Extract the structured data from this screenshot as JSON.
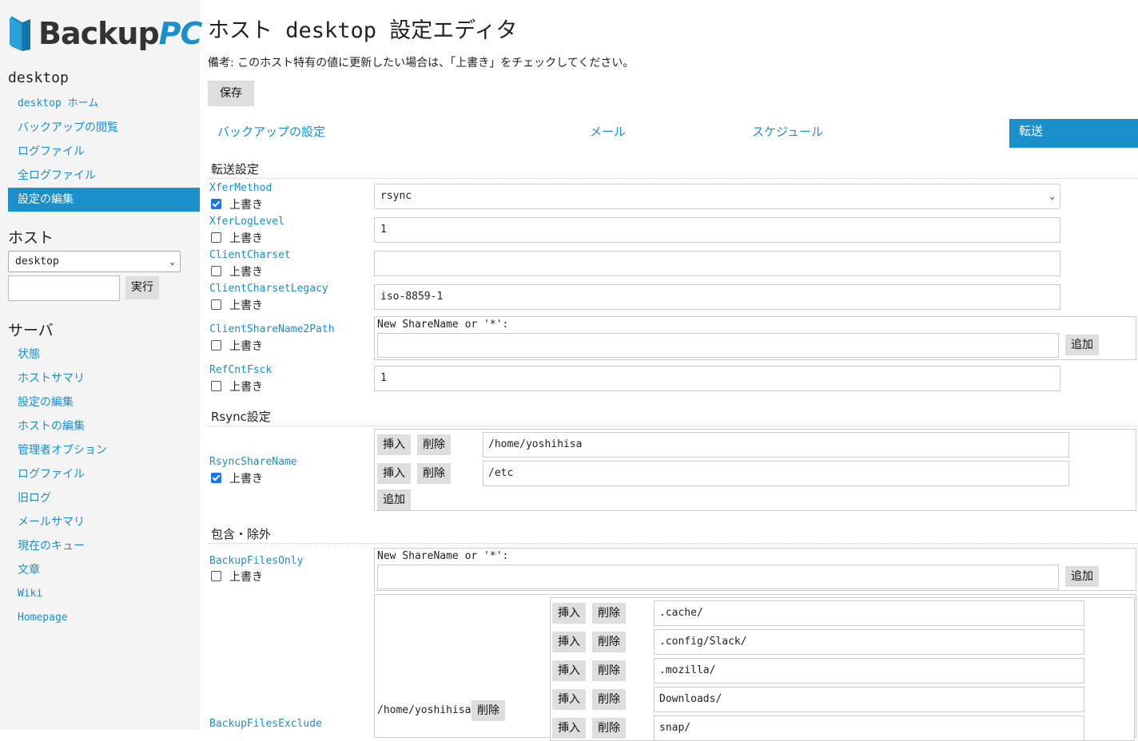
{
  "brand": {
    "name_a": "Backup",
    "name_b": "PC",
    "accent": "#1a8fc9"
  },
  "sidebar": {
    "host_heading": "desktop",
    "host_links": [
      "desktop ホーム",
      "バックアップの閲覧",
      "ログファイル",
      "全ログファイル",
      "設定の編集"
    ],
    "hosts_heading": "ホスト",
    "host_select_value": "desktop",
    "go_label": "実行",
    "server_heading": "サーバ",
    "server_links": [
      "状態",
      "ホストサマリ",
      "設定の編集",
      "ホストの編集",
      "管理者オプション",
      "ログファイル",
      "旧ログ",
      "メールサマリ",
      "現在のキュー",
      "文章",
      "Wiki",
      "Homepage"
    ]
  },
  "main": {
    "title": "ホスト desktop 設定エディタ",
    "note": "備考: このホスト特有の値に更新したい場合は、「上書き」をチェックしてください。",
    "save_label": "保存",
    "tabs": [
      "バックアップの設定",
      "メール",
      "スケジュール",
      "転送"
    ],
    "override_label": "上書き",
    "insert_label": "挿入",
    "delete_label": "削除",
    "add_label": "追加",
    "new_share_label": "New ShareName or '*':",
    "sections": {
      "xfer": "転送設定",
      "rsync": "Rsync設定",
      "include": "包含・除外"
    },
    "params": {
      "XferMethod": {
        "name": "XferMethod",
        "value": "rsync",
        "override": true
      },
      "XferLogLevel": {
        "name": "XferLogLevel",
        "value": "1",
        "override": false
      },
      "ClientCharset": {
        "name": "ClientCharset",
        "value": "",
        "override": false
      },
      "ClientCharsetLegacy": {
        "name": "ClientCharsetLegacy",
        "value": "iso-8859-1",
        "override": false
      },
      "ClientShareName2Path": {
        "name": "ClientShareName2Path",
        "override": false
      },
      "RefCntFsck": {
        "name": "RefCntFsck",
        "value": "1",
        "override": false
      },
      "RsyncShareName": {
        "name": "RsyncShareName",
        "override": true,
        "values": [
          "/home/yoshihisa",
          "/etc"
        ]
      },
      "BackupFilesOnly": {
        "name": "BackupFilesOnly",
        "override": false
      },
      "BackupFilesExclude": {
        "name": "BackupFilesExclude",
        "share": "/home/yoshihisa",
        "values": [
          ".cache/",
          ".config/Slack/",
          ".mozilla/",
          "Downloads/",
          "snap/"
        ]
      }
    }
  }
}
